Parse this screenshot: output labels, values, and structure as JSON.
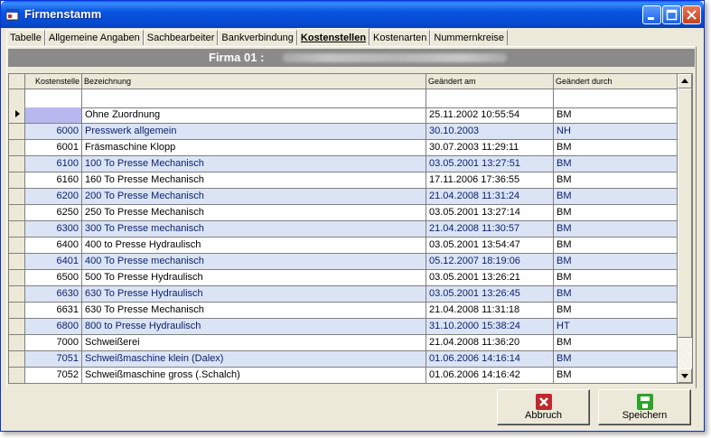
{
  "window": {
    "title": "Firmenstamm"
  },
  "tabs": [
    {
      "label": "Tabelle"
    },
    {
      "label": "Allgemeine Angaben"
    },
    {
      "label": "Sachbearbeiter"
    },
    {
      "label": "Bankverbindung"
    },
    {
      "label": "Kostenstellen",
      "active": true
    },
    {
      "label": "Kostenarten"
    },
    {
      "label": "Nummernkreise"
    }
  ],
  "firma": {
    "label": "Firma 01 :"
  },
  "grid": {
    "columns": [
      "Kostenstelle",
      "Bezeichnung",
      "Geändert am",
      "Geändert durch"
    ],
    "rows": [
      {
        "kst": "",
        "bez": "Ohne Zuordnung",
        "datum": "25.11.2002 10:55:54",
        "durch": "BM"
      },
      {
        "kst": "6000",
        "bez": "Presswerk allgemein",
        "datum": "30.10.2003",
        "durch": "NH"
      },
      {
        "kst": "6001",
        "bez": "Fräsmaschine Klopp",
        "datum": "30.07.2003 11:29:11",
        "durch": "BM"
      },
      {
        "kst": "6100",
        "bez": "100 To Presse Mechanisch",
        "datum": "03.05.2001 13:27:51",
        "durch": "BM"
      },
      {
        "kst": "6160",
        "bez": "160 To Presse Mechanisch",
        "datum": "17.11.2006 17:36:55",
        "durch": "BM"
      },
      {
        "kst": "6200",
        "bez": "200 To Presse Mechanisch",
        "datum": "21.04.2008 11:31:24",
        "durch": "BM"
      },
      {
        "kst": "6250",
        "bez": "250 To Presse Mechanisch",
        "datum": "03.05.2001 13:27:14",
        "durch": "BM"
      },
      {
        "kst": "6300",
        "bez": "300 To Presse mechanisch",
        "datum": "21.04.2008 11:30:57",
        "durch": "BM"
      },
      {
        "kst": "6400",
        "bez": "400 to Presse Hydraulisch",
        "datum": "03.05.2001 13:54:47",
        "durch": "BM"
      },
      {
        "kst": "6401",
        "bez": "400 To Presse mechanisch",
        "datum": "05.12.2007 18:19:06",
        "durch": "BM"
      },
      {
        "kst": "6500",
        "bez": "500 To Presse Hydraulisch",
        "datum": "03.05.2001 13:26:21",
        "durch": "BM"
      },
      {
        "kst": "6630",
        "bez": "630 To Presse Hydraulisch",
        "datum": "03.05.2001 13:26:45",
        "durch": "BM"
      },
      {
        "kst": "6631",
        "bez": "630 To Presse Mechanisch",
        "datum": "21.04.2008 11:31:18",
        "durch": "BM"
      },
      {
        "kst": "6800",
        "bez": "800 to Presse Hydraulisch",
        "datum": "31.10.2000 15:38:24",
        "durch": "HT"
      },
      {
        "kst": "7000",
        "bez": "Schweißerei",
        "datum": "21.04.2008 11:36:20",
        "durch": "BM"
      },
      {
        "kst": "7051",
        "bez": "Schweißmaschine klein (Dalex)",
        "datum": "01.06.2006 14:16:14",
        "durch": "BM"
      },
      {
        "kst": "7052",
        "bez": "Schweißmaschine gross (.Schalch)",
        "datum": "01.06.2006 14:16:42",
        "durch": "BM"
      }
    ]
  },
  "buttons": {
    "abbruch": {
      "label": "Abbruch",
      "icon": "cancel-x-icon",
      "color": "#c0282d"
    },
    "speichern": {
      "label": "Speichern",
      "icon": "floppy-disk-icon",
      "color": "#2aa52a"
    }
  },
  "colors": {
    "alt_row": "#dbe4f5",
    "alt_text": "#0a1f6e",
    "title_blue": "#0855e0"
  }
}
